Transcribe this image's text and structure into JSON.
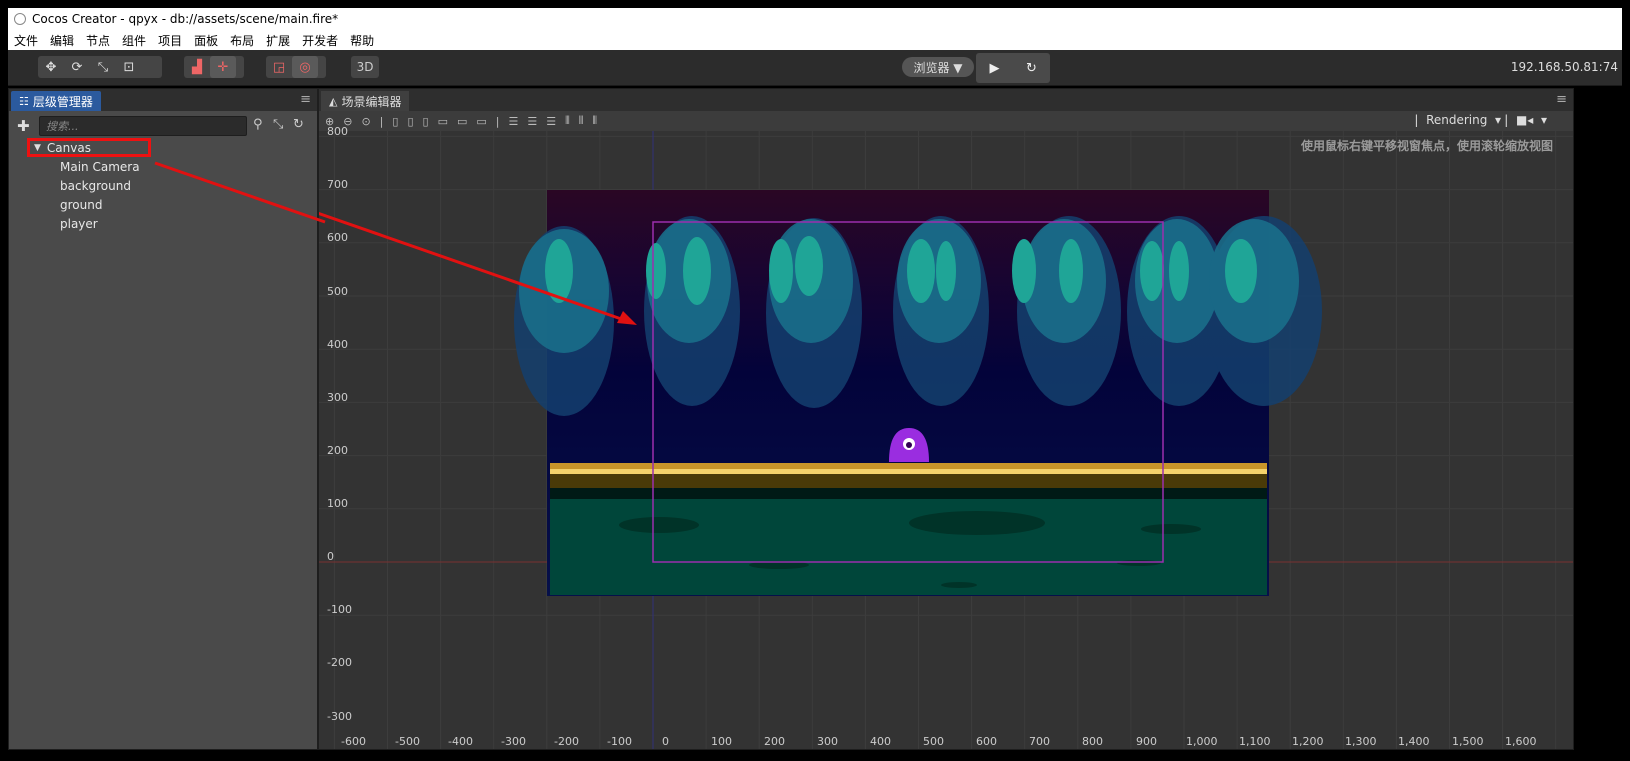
{
  "window": {
    "title": "Cocos Creator - qpyx - db://assets/scene/main.fire*"
  },
  "menu": [
    "文件",
    "编辑",
    "节点",
    "组件",
    "项目",
    "面板",
    "布局",
    "扩展",
    "开发者",
    "帮助"
  ],
  "toolbar": {
    "mode_3d": "3D",
    "preview_label": "浏览器 ▼",
    "play_glyph": "▶",
    "refresh_glyph": "↻",
    "ip": "192.168.50.81:74"
  },
  "hierarchy": {
    "tab_label": "层级管理器",
    "search_placeholder": "搜索...",
    "tree": {
      "root": "Canvas",
      "children": [
        "Main Camera",
        "background",
        "ground",
        "player"
      ]
    }
  },
  "scene": {
    "tab_label": "场景编辑器",
    "rendering_label": "Rendering",
    "hint": "使用鼠标右键平移视窗焦点，使用滚轮缩放视图",
    "y_ticks": [
      "800",
      "700",
      "600",
      "500",
      "400",
      "300",
      "200",
      "100",
      "0",
      "-100",
      "-200",
      "-300"
    ],
    "x_ticks": [
      "-600",
      "-500",
      "-400",
      "-300",
      "-200",
      "-100",
      "0",
      "100",
      "200",
      "300",
      "400",
      "500",
      "600",
      "700",
      "800",
      "900",
      "1,000",
      "1,100",
      "1,200",
      "1,300",
      "1,400",
      "1,500",
      "1,600"
    ]
  },
  "colors": {
    "hierarchy_tab": "#2b5a9e",
    "highlight_box": "#e11111",
    "annotation_arrow": "#e11111",
    "design_frame": "#9b2fae",
    "player": "#9a2de0"
  }
}
